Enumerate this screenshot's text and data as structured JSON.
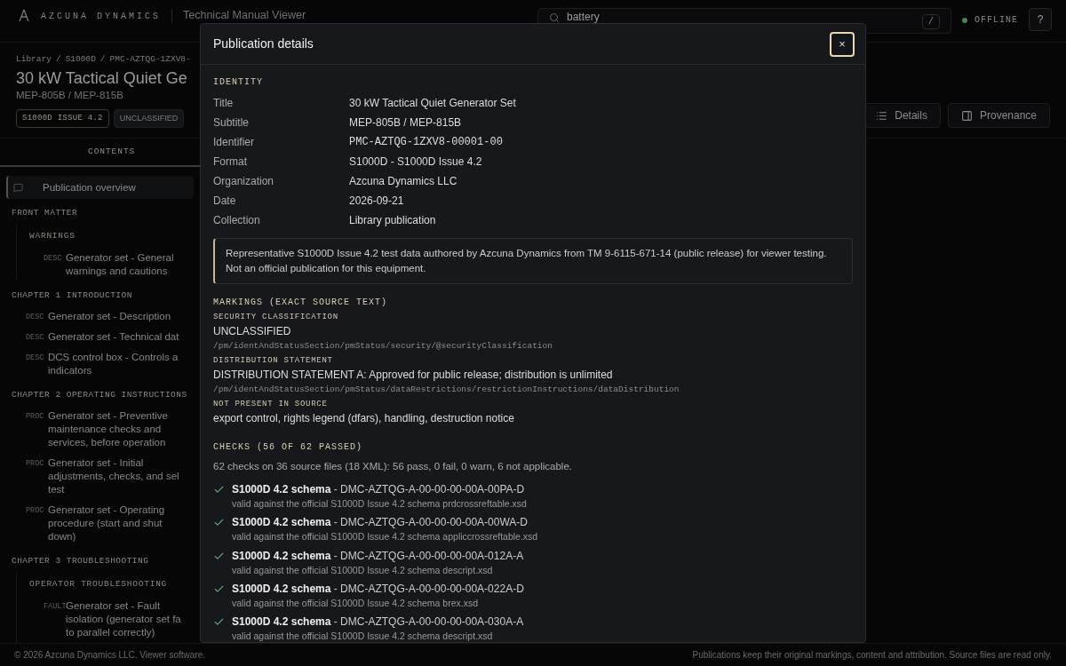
{
  "header": {
    "brand": "AZCUNA DYNAMICS",
    "app_title": "Technical Manual Viewer",
    "search": {
      "value": "battery",
      "shortcut": "/"
    },
    "status": {
      "label": "OFFLINE",
      "color": "#3a8a55"
    },
    "help": "?"
  },
  "publication": {
    "breadcrumb": [
      "Library",
      "S1000D",
      "PMC-AZTQG-1ZXV8-"
    ],
    "separator": "/",
    "title": "30 kW Tactical Quiet Ge",
    "subtitle": "MEP-805B / MEP-815B",
    "badges": [
      {
        "label": "S1000D ISSUE 4.2",
        "kind": "outlined"
      },
      {
        "label": "UNCLASSIFIED",
        "kind": "filled"
      }
    ],
    "actions": [
      {
        "label": "Details",
        "kind": "list"
      },
      {
        "label": "Provenance",
        "kind": "panel"
      }
    ]
  },
  "sidebar": {
    "tab": {
      "label": "CONTENTS",
      "selected": true
    },
    "overview": {
      "label": "Publication overview",
      "selected": true
    },
    "sections": [
      {
        "title": "FRONT MATTER",
        "children": [
          {
            "kind": "group",
            "title": "WARNINGS",
            "children": [
              {
                "kind": "item",
                "tag": "DESC",
                "lines": [
                  "Generator set - General",
                  "warnings and cautions"
                ]
              }
            ]
          }
        ]
      },
      {
        "title": "CHAPTER 1 INTRODUCTION",
        "children": [
          {
            "kind": "item",
            "tag": "DESC",
            "lines": [
              "Generator set - Description"
            ]
          },
          {
            "kind": "item",
            "tag": "DESC",
            "lines": [
              "Generator set - Technical dat"
            ]
          },
          {
            "kind": "item",
            "tag": "DESC",
            "lines": [
              "DCS control box - Controls a",
              "indicators"
            ]
          }
        ]
      },
      {
        "title": "CHAPTER 2 OPERATING INSTRUCTIONS",
        "children": [
          {
            "kind": "item",
            "tag": "PROC",
            "lines": [
              "Generator set - Preventive",
              "maintenance checks and",
              "services, before operation"
            ]
          },
          {
            "kind": "item",
            "tag": "PROC",
            "lines": [
              "Generator set - Initial",
              "adjustments, checks, and sel",
              "test"
            ]
          },
          {
            "kind": "item",
            "tag": "PROC",
            "lines": [
              "Generator set - Operating",
              "procedure (start and shut",
              "down)"
            ]
          }
        ]
      },
      {
        "title": "CHAPTER 3 TROUBLESHOOTING",
        "children": [
          {
            "kind": "group",
            "title": "OPERATOR TROUBLESHOOTING",
            "children": [
              {
                "kind": "item",
                "tag": "FAULT",
                "lines": [
                  "Generator set - Fault",
                  "isolation (generator set fa",
                  "to parallel correctly)"
                ]
              }
            ]
          }
        ]
      }
    ]
  },
  "footer": {
    "left": "© 2026 Azcuna Dynamics LLC. Viewer software.",
    "right": "Publications keep their original markings, content and attribution. Source files are read only."
  },
  "dialog": {
    "title": "Publication details",
    "close": "×",
    "identity": {
      "heading": "IDENTITY",
      "fields": [
        {
          "label": "Title",
          "value": "30 kW Tactical Quiet Generator Set",
          "kind": "text"
        },
        {
          "label": "Subtitle",
          "value": "MEP-805B / MEP-815B",
          "kind": "text"
        },
        {
          "label": "Identifier",
          "value": "PMC-AZTQG-1ZXV8-00001-00",
          "kind": "code"
        },
        {
          "label": "Format",
          "value": "S1000D - S1000D Issue 4.2",
          "kind": "text"
        },
        {
          "label": "Organization",
          "value": "Azcuna Dynamics LLC",
          "kind": "text"
        },
        {
          "label": "Date",
          "value": "2026-09-21",
          "kind": "text"
        },
        {
          "label": "Collection",
          "value": "Library publication",
          "kind": "text"
        }
      ]
    },
    "notice": "Representative S1000D Issue 4.2 test data authored by Azcuna Dynamics from TM 9-6115-671-14 (public release) for viewer testing. Not an official publication for this equipment.",
    "markings": {
      "heading": "MARKINGS (EXACT SOURCE TEXT)",
      "entries": [
        {
          "label": "SECURITY CLASSIFICATION",
          "value": "UNCLASSIFIED",
          "path": "/pm/identAndStatusSection/pmStatus/security/@securityClassification"
        },
        {
          "label": "DISTRIBUTION STATEMENT",
          "value": "DISTRIBUTION STATEMENT A: Approved for public release; distribution is unlimited",
          "path": "/pm/identAndStatusSection/pmStatus/dataRestrictions/restrictionInstructions/dataDistribution"
        },
        {
          "label": "NOT PRESENT IN SOURCE",
          "value": "export control, rights legend (dfars), handling, destruction notice"
        }
      ]
    },
    "checks": {
      "heading": "CHECKS (56 OF 62 PASSED)",
      "summary": "62 checks on 36 source files (18 XML): 56 pass, 0 fail, 0 warn, 6 not applicable.",
      "items": [
        {
          "kind": "pass",
          "title": "**S1000D 4.2 schema** - DMC-AZTQG-A-00-00-00-00A-00PA-D",
          "detail": "valid against the official S1000D Issue 4.2 schema prdcrossreftable.xsd"
        },
        {
          "kind": "pass",
          "title": "**S1000D 4.2 schema** - DMC-AZTQG-A-00-00-00-00A-00WA-D",
          "detail": "valid against the official S1000D Issue 4.2 schema appliccrossreftable.xsd"
        },
        {
          "kind": "pass",
          "title": "**S1000D 4.2 schema** - DMC-AZTQG-A-00-00-00-00A-012A-A",
          "detail": "valid against the official S1000D Issue 4.2 schema descript.xsd"
        },
        {
          "kind": "pass",
          "title": "**S1000D 4.2 schema** - DMC-AZTQG-A-00-00-00-00A-022A-D",
          "detail": "valid against the official S1000D Issue 4.2 schema brex.xsd"
        },
        {
          "kind": "pass",
          "title": "**S1000D 4.2 schema** - DMC-AZTQG-A-00-00-00-00A-030A-A",
          "detail": "valid against the official S1000D Issue 4.2 schema descript.xsd"
        }
      ]
    }
  }
}
